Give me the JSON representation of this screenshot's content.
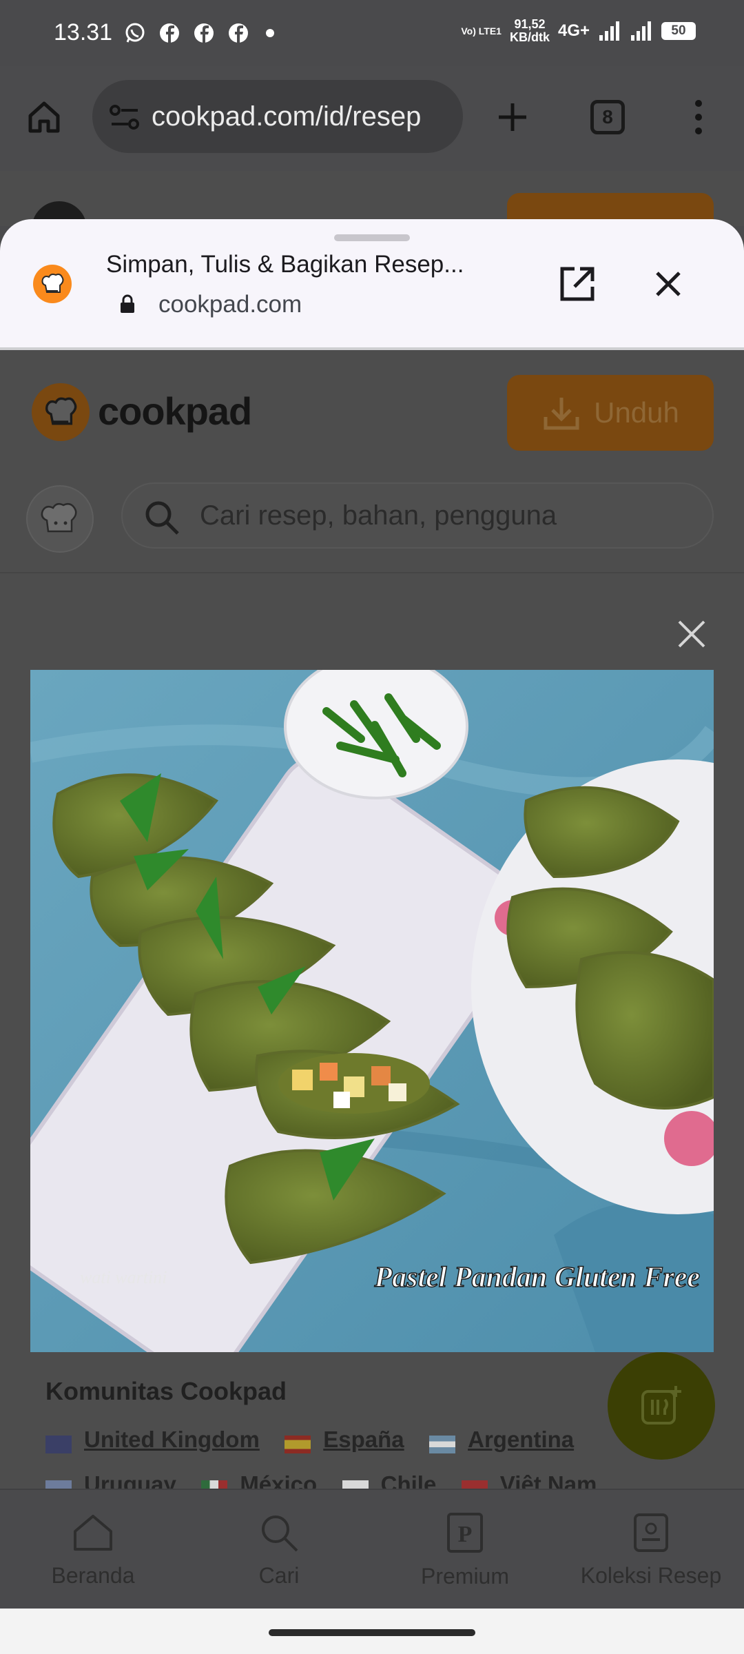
{
  "status_bar": {
    "time": "13.31",
    "network_label": "Vo) LTE1",
    "speed_value": "91,52",
    "speed_unit": "KB/dtk",
    "network_type": "4G+",
    "battery": "50"
  },
  "browser": {
    "url": "cookpad.com/id/resep",
    "tab_count": "8"
  },
  "custom_tab": {
    "title": "Simpan, Tulis & Bagikan Resep...",
    "domain": "cookpad.com"
  },
  "page": {
    "brand": "cookpad",
    "download_label": "Unduh",
    "search_placeholder": "Cari resep, bahan, pengguna",
    "photo_watermark": "wati wartini",
    "photo_caption": "Pastel Pandan Gluten Free",
    "community_title": "Komunitas Cookpad",
    "countries_row1": [
      {
        "name": "United Kingdom",
        "flag": "gb"
      },
      {
        "name": "España",
        "flag": "es"
      },
      {
        "name": "Argentina",
        "flag": "ar"
      }
    ],
    "countries_row2": [
      {
        "name": "Uruguay",
        "flag": "uy"
      },
      {
        "name": "México",
        "flag": "mx"
      },
      {
        "name": "Chile",
        "flag": "cl"
      },
      {
        "name": "Việt Nam",
        "flag": "vn"
      }
    ]
  },
  "bottom_nav": [
    {
      "label": "Beranda",
      "icon": "home-icon"
    },
    {
      "label": "Cari",
      "icon": "search-icon"
    },
    {
      "label": "Premium",
      "icon": "premium-icon"
    },
    {
      "label": "Koleksi Resep",
      "icon": "recipe-book-icon"
    }
  ],
  "colors": {
    "brand_orange": "#fa8a1c",
    "overlay": "#4d4d4d",
    "sheet_bg": "#f7f5fb"
  }
}
